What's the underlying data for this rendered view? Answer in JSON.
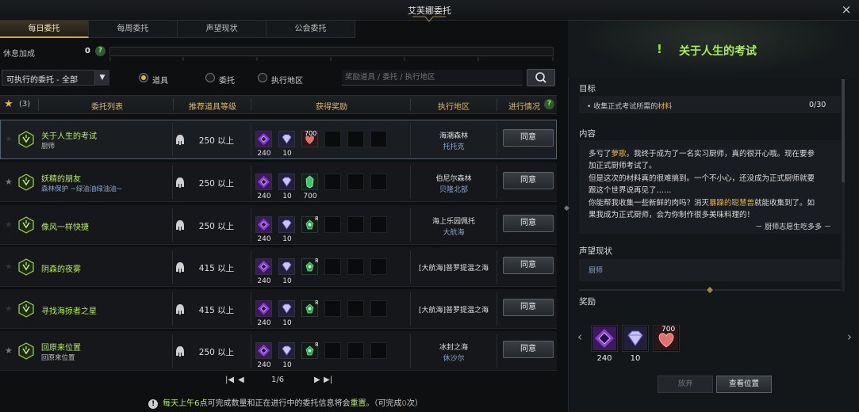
{
  "window": {
    "title": "艾芙娜委托",
    "close_icon": "×"
  },
  "tabs": [
    {
      "label": "每日委托",
      "active": true
    },
    {
      "label": "每周委托",
      "active": false
    },
    {
      "label": "声望现状",
      "active": false
    },
    {
      "label": "公会委托",
      "active": false
    }
  ],
  "rest_bonus": {
    "label": "休息加成",
    "value": "0",
    "help": "?"
  },
  "filter": {
    "select_value": "可执行的委托 - 全部",
    "radios": [
      {
        "label": "道具",
        "checked": true
      },
      {
        "label": "委托",
        "checked": false
      },
      {
        "label": "执行地区",
        "checked": false
      }
    ],
    "search_placeholder": "奖励道具 / 委托 / 执行地区"
  },
  "table": {
    "star_count": "(3)",
    "headers": {
      "list": "委托列表",
      "level": "推荐道具等级",
      "reward": "获得奖励",
      "location": "执行地区",
      "progress": "进行情况",
      "progress_help": "?"
    },
    "agree_label": "同意",
    "rows": [
      {
        "name": "关于人生的考试",
        "sub": "厨师",
        "sub_blue": false,
        "level": "250 以上",
        "rewards": [
          "240",
          "10",
          ""
        ],
        "third_badge": "700",
        "third_type": "heart",
        "loc1": "海潮森林",
        "loc2": "托托克",
        "starred": false,
        "selected": true
      },
      {
        "name": "妖精的朋友",
        "sub": "森林保护 ~绿油油绿油油~",
        "sub_blue": true,
        "level": "250 以上",
        "rewards": [
          "240",
          "10",
          "700"
        ],
        "third_badge": "",
        "third_type": "crystal",
        "loc1": "伯尼尔森林",
        "loc2": "贝隆北部",
        "starred": true,
        "selected": false
      },
      {
        "name": "像风一样快捷",
        "sub": "",
        "sub_blue": false,
        "level": "250 以上",
        "rewards": [
          "240",
          "10",
          ""
        ],
        "third_badge": "8",
        "third_type": "gem",
        "loc1": "海上乐园佩托",
        "loc2": "大航海",
        "starred": false,
        "selected": false
      },
      {
        "name": "阴森的夜雾",
        "sub": "",
        "sub_blue": false,
        "level": "415 以上",
        "rewards": [
          "240",
          "10",
          ""
        ],
        "third_badge": "8",
        "third_type": "gem",
        "loc1": "[大航海]普罗提温之海",
        "loc2": "",
        "starred": false,
        "selected": false
      },
      {
        "name": "寻找海掠者之星",
        "sub": "",
        "sub_blue": false,
        "level": "415 以上",
        "rewards": [
          "240",
          "10",
          ""
        ],
        "third_badge": "8",
        "third_type": "gem",
        "loc1": "[大航海]普罗提温之海",
        "loc2": "",
        "starred": false,
        "selected": false
      },
      {
        "name": "回原来位置",
        "sub": "回原来位置",
        "sub_blue": false,
        "level": "250 以上",
        "rewards": [
          "240",
          "10",
          ""
        ],
        "third_badge": "8",
        "third_type": "gem",
        "loc1": "冰封之海",
        "loc2": "休沙尔",
        "starred": true,
        "selected": false
      }
    ]
  },
  "pager": {
    "first": "|◀",
    "prev": "◀",
    "text": "1/6",
    "next": "▶",
    "last": "▶|"
  },
  "notice": {
    "icon": "!",
    "part1": "每天上午6点",
    "part2": "可完成数量和正在进行中的委托信息将会",
    "part3": "重置",
    "part4": "。（可完成",
    "part5": "0",
    "part6": "次）"
  },
  "detail": {
    "title": "关于人生的考试",
    "goal_label": "目标",
    "goal_prefix": "•",
    "goal_text_a": "收集正式考试所需的",
    "goal_text_b": "材料",
    "goal_count": "0/30",
    "content_label": "内容",
    "content": {
      "l1a": "多亏了",
      "l1b": "萝歌",
      "l1c": "，我终于成为了一名实习厨师，真的很开心哦。现在要参",
      "l2": "加正式厨师考试了。",
      "l3": "但是这次的材料真的很难搞到。一个不小心，还没成为正式厨师就要",
      "l4": "跟这个世界说再见了……",
      "l5a": "你能帮我收集一些新鲜的肉吗？消灭",
      "l5b": "暴躁的聪慧兽",
      "l5c": "就能收集到了。如",
      "l6": "果我成为正式厨师，会为你制作很多美味料理的！",
      "signature": "－ 厨师志愿生吃多多 －"
    },
    "reputation_label": "声望现状",
    "reputation_item": "厨师",
    "reward_label": "奖励",
    "rewards": [
      {
        "value": "240"
      },
      {
        "value": "10"
      },
      {
        "value": "",
        "badge": "700"
      }
    ],
    "abandon": "放弃",
    "view_location": "查看位置"
  },
  "colors": {
    "accent_green": "#b6ea5c",
    "gold": "#d6b970",
    "highlight": "#e7b53c",
    "link_blue": "#8aa6d0"
  }
}
